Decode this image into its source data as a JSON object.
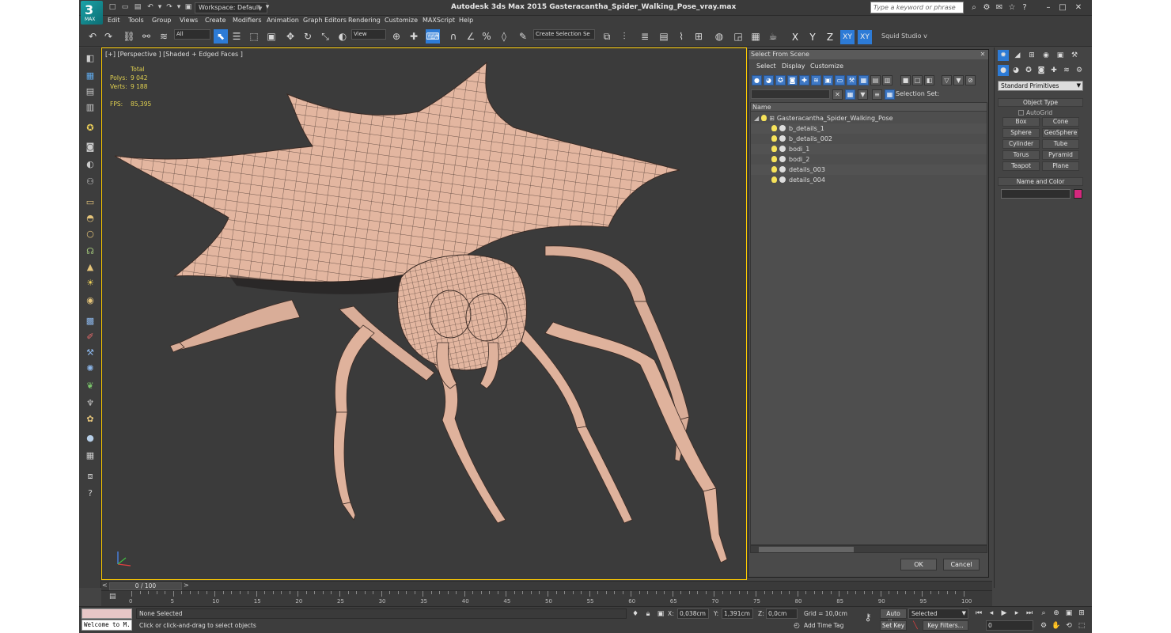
{
  "app": {
    "logo_text": "3",
    "logo_sub": "MAX",
    "window_title": "Autodesk 3ds Max  2015     Gasteracantha_Spider_Walking_Pose_vray.max",
    "workspace_value": "Workspace: Default",
    "search_placeholder": "Type a keyword or phrase"
  },
  "menu": [
    "Edit",
    "Tools",
    "Group",
    "Views",
    "Create",
    "Modifiers",
    "Animation",
    "Graph Editors",
    "Rendering",
    "Customize",
    "MAXScript",
    "Help"
  ],
  "toolbar": {
    "filter_value": "All",
    "refcoord_value": "View",
    "named_selection_value": "Create Selection Se",
    "axis_x": "X",
    "axis_y": "Y",
    "axis_z": "Z",
    "axis_xy": "XY",
    "axis_xy2": "XY",
    "squid_label": "Squid Studio v"
  },
  "viewport": {
    "label": "[+] [Perspective ] [Shaded + Edged Faces ]",
    "stats": {
      "total_label": "Total",
      "polys_label": "Polys:",
      "polys_value": "9 042",
      "verts_label": "Verts:",
      "verts_value": "9 188",
      "fps_label": "FPS:",
      "fps_value": "85,395"
    },
    "colors": {
      "mesh": "#e3b6a0",
      "wire": "#3a2a24",
      "background": "#3b3b3b",
      "active_border": "#ffcc00"
    }
  },
  "scene_dialog": {
    "title": "Select From Scene",
    "menu": [
      "Select",
      "Display",
      "Customize"
    ],
    "selection_set_label": "Selection Set:",
    "column_name": "Name",
    "root": "Gasteracantha_Spider_Walking_Pose",
    "objects": [
      "b_details_1",
      "b_details_002",
      "bodi_1",
      "bodi_2",
      "details_003",
      "details_004"
    ],
    "ok_label": "OK",
    "cancel_label": "Cancel"
  },
  "command_panel": {
    "dropdown_value": "Standard Primitives",
    "object_type_title": "Object Type",
    "autogrid_label": "AutoGrid",
    "primitives": [
      "Box",
      "Cone",
      "Sphere",
      "GeoSphere",
      "Cylinder",
      "Tube",
      "Torus",
      "Pyramid",
      "Teapot",
      "Plane"
    ],
    "name_color_title": "Name and Color",
    "swatch_color": "#d4287d"
  },
  "timeline": {
    "frame_display": "0 / 100",
    "tick_labels": [
      "0",
      "5",
      "10",
      "15",
      "20",
      "25",
      "30",
      "35",
      "40",
      "45",
      "50",
      "55",
      "60",
      "65",
      "70",
      "75",
      "80",
      "85",
      "90",
      "95",
      "100"
    ]
  },
  "status": {
    "listener_text": "Welcome to M.",
    "selection_text": "None Selected",
    "prompt_text": "Click or click-and-drag to select objects",
    "x_label": "X:",
    "x_value": "0,038cm",
    "y_label": "Y:",
    "y_value": "1,391cm",
    "z_label": "Z:",
    "z_value": "0,0cm",
    "grid_text": "Grid = 10,0cm",
    "add_time_tag": "Add Time Tag",
    "auto_key": "Auto Key",
    "set_key": "Set Key",
    "selected_value": "Selected",
    "key_filters": "Key Filters...",
    "frame_value": "0"
  }
}
